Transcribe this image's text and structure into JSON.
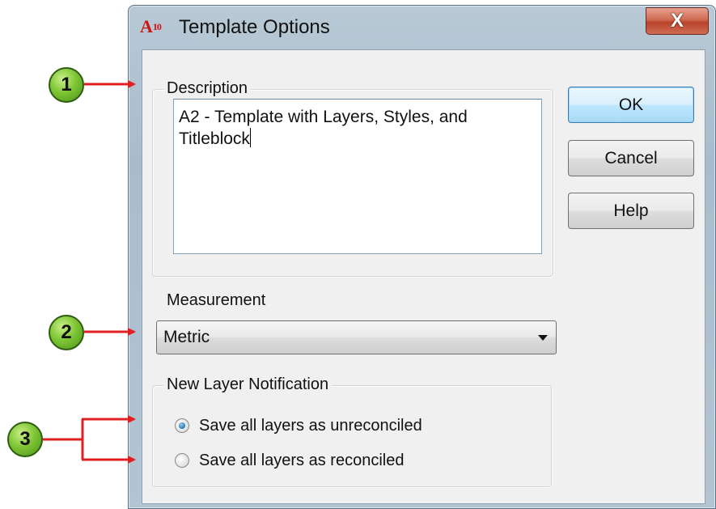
{
  "window": {
    "title": "Template Options",
    "app_icon_text": "A",
    "app_icon_sub": "10",
    "close_label": "X"
  },
  "description": {
    "legend": "Description",
    "value_line1": "A2 - Template with Layers, Styles, and",
    "value_line2": "Titleblock"
  },
  "measurement": {
    "label": "Measurement",
    "selected": "Metric"
  },
  "new_layer_notification": {
    "legend": "New Layer Notification",
    "options": [
      {
        "label": "Save all layers as unreconciled",
        "checked": true
      },
      {
        "label": "Save all layers as reconciled",
        "checked": false
      }
    ]
  },
  "buttons": {
    "ok": "OK",
    "cancel": "Cancel",
    "help": "Help"
  },
  "callouts": [
    "1",
    "2",
    "3"
  ],
  "colors": {
    "callout_green": "#7fc635",
    "arrow_red": "#e02020",
    "accent_blue": "#3c7fb1"
  }
}
